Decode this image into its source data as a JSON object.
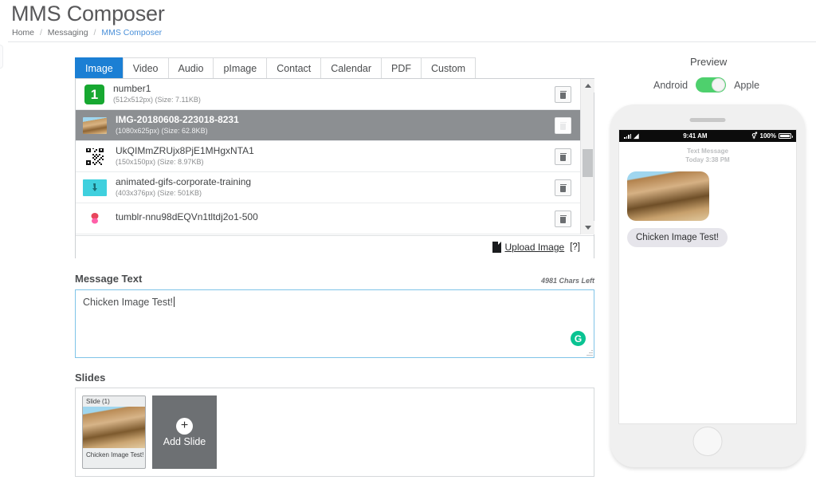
{
  "header": {
    "title": "MMS Composer",
    "breadcrumb": {
      "home": "Home",
      "section": "Messaging",
      "current": "MMS Composer",
      "separator": "/"
    }
  },
  "tabs": [
    {
      "label": "Image",
      "active": true
    },
    {
      "label": "Video",
      "active": false
    },
    {
      "label": "Audio",
      "active": false
    },
    {
      "label": "pImage",
      "active": false
    },
    {
      "label": "Contact",
      "active": false
    },
    {
      "label": "Calendar",
      "active": false
    },
    {
      "label": "PDF",
      "active": false
    },
    {
      "label": "Custom",
      "active": false
    }
  ],
  "file_list": {
    "rows": [
      {
        "name": "number1",
        "meta": "(512x512px) (Size: 7.11KB)",
        "thumb": "green-number-1-icon",
        "selected": false
      },
      {
        "name": "IMG-20180608-223018-8231",
        "meta": "(1080x625px) (Size: 62.8KB)",
        "thumb": "chicken-photo-icon",
        "selected": true
      },
      {
        "name": "UkQIMmZRUjx8PjE1MHgxNTA1",
        "meta": "(150x150px) (Size: 8.97KB)",
        "thumb": "qr-code-icon",
        "selected": false
      },
      {
        "name": "animated-gifs-corporate-training",
        "meta": "(403x376px) (Size: 501KB)",
        "thumb": "cyan-gif-icon",
        "selected": false
      },
      {
        "name": "tumblr-nnu98dEQVn1tltdj2o1-500",
        "meta": "",
        "thumb": "pink-blob-icon",
        "selected": false
      }
    ],
    "delete_tooltip": "Delete",
    "upload_label": "Upload Image",
    "help_label": "[?]"
  },
  "message": {
    "label": "Message Text",
    "chars_left": "4981 Chars Left",
    "value": "Chicken Image Test!",
    "placeholder": "",
    "regen_glyph": "G"
  },
  "slides": {
    "label": "Slides",
    "items": [
      {
        "title": "Slide (1)",
        "caption": "Chicken Image Test!"
      }
    ],
    "add_label": "Add Slide",
    "add_glyph": "+"
  },
  "preview": {
    "title": "Preview",
    "toggle_left": "Android",
    "toggle_right": "Apple",
    "toggle_on": true,
    "accent_green": "#4ed06d",
    "phone": {
      "status_time": "9:41 AM",
      "status_battery": "100%",
      "thread_label": "Text Message",
      "thread_time": "Today 3:38 PM",
      "bubble_text": "Chicken Image Test!"
    }
  },
  "colors": {
    "tab_active": "#1b7fd4",
    "row_selected": "#8c8f92",
    "regen": "#09c392",
    "breadcrumb_link": "#4a90d9"
  }
}
